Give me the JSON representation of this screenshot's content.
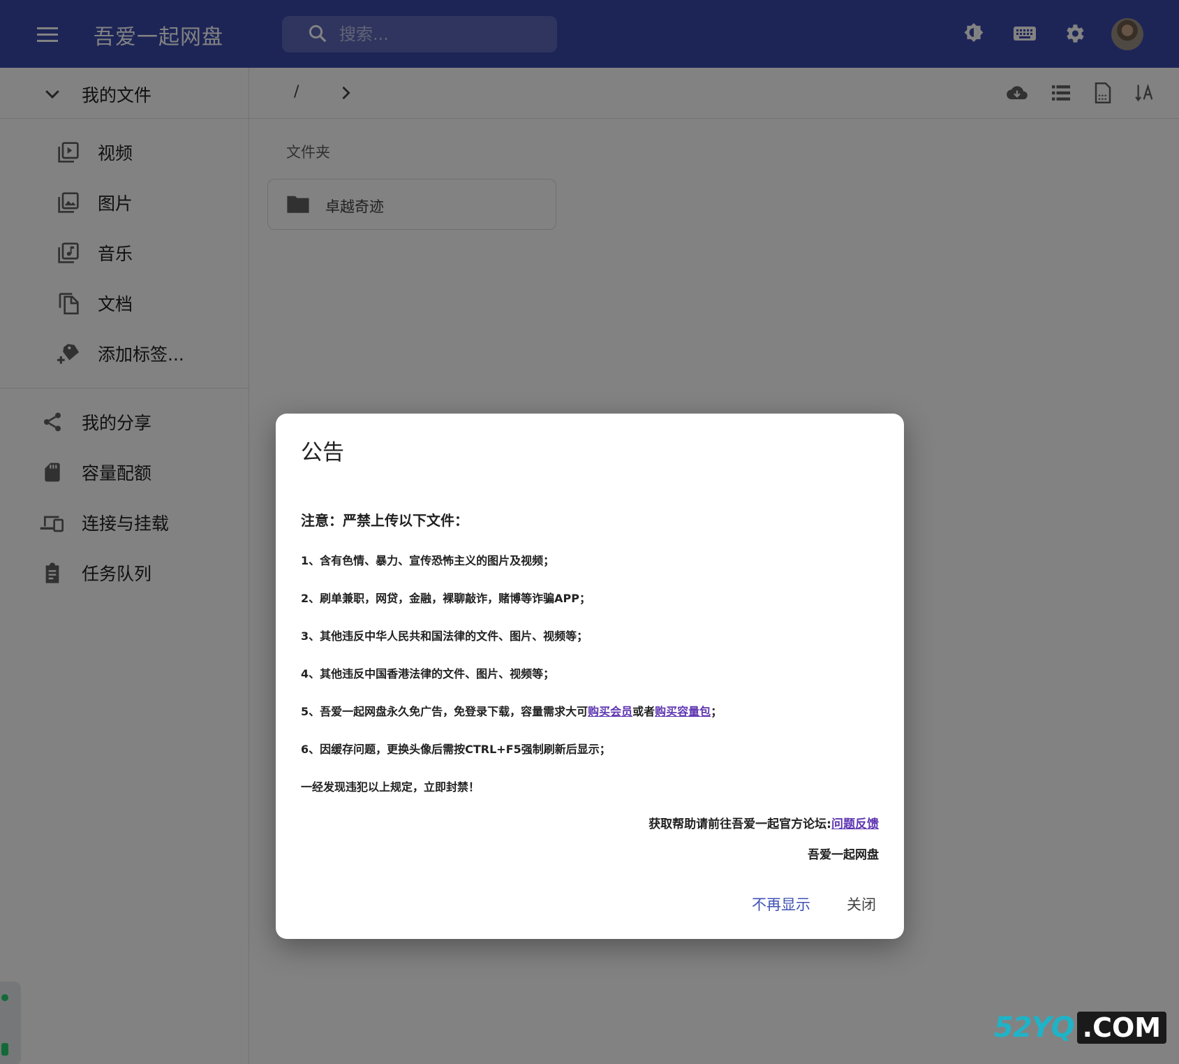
{
  "colors": {
    "appbar": "#3949ab",
    "accent": "#3f51b5",
    "link": "#5e35b1"
  },
  "appbar": {
    "title": "吾爱一起网盘",
    "search_placeholder": "搜索...",
    "icons": [
      "menu-icon",
      "theme-toggle-icon",
      "keyboard-icon",
      "settings-icon"
    ]
  },
  "sidebar": {
    "header": "我的文件",
    "file_types": [
      {
        "label": "视频",
        "icon": "video-library-icon"
      },
      {
        "label": "图片",
        "icon": "photo-library-icon"
      },
      {
        "label": "音乐",
        "icon": "music-library-icon"
      },
      {
        "label": "文档",
        "icon": "document-copy-icon"
      },
      {
        "label": "添加标签...",
        "icon": "add-tag-icon"
      }
    ],
    "items": [
      {
        "label": "我的分享",
        "icon": "share-icon"
      },
      {
        "label": "容量配额",
        "icon": "sd-card-icon"
      },
      {
        "label": "连接与挂载",
        "icon": "devices-icon"
      },
      {
        "label": "任务队列",
        "icon": "clipboard-icon"
      }
    ]
  },
  "main": {
    "breadcrumb_root": "/",
    "section_label": "文件夹",
    "folders": [
      {
        "name": "卓越奇迹"
      }
    ]
  },
  "dialog": {
    "title": "公告",
    "heading": "注意：严禁上传以下文件：",
    "rules": {
      "r1": "1、含有色情、暴力、宣传恐怖主义的图片及视频；",
      "r2": "2、刷单兼职，网贷，金融，裸聊敲诈，赌博等诈骗APP；",
      "r3": "3、其他违反中华人民共和国法律的文件、图片、视频等；",
      "r4": "4、其他违反中国香港法律的文件、图片、视频等；",
      "r5_pre": "5、吾爱一起网盘永久免广告，免登录下载，容量需求大可",
      "r5_link1": "购买会员",
      "r5_mid": "或者",
      "r5_link2": "购买容量包",
      "r5_post": "；",
      "r6": "6、因缓存问题，更换头像后需按CTRL+F5强制刷新后显示；"
    },
    "warning": "一经发现违犯以上规定，立即封禁！",
    "help_pre": "获取帮助请前往吾爱一起官方论坛:",
    "help_link": "问题反馈",
    "signature": "吾爱一起网盘",
    "btn_dont_show": "不再显示",
    "btn_close": "关闭"
  },
  "watermark": {
    "left": "52YQ",
    "right": ".COM"
  }
}
